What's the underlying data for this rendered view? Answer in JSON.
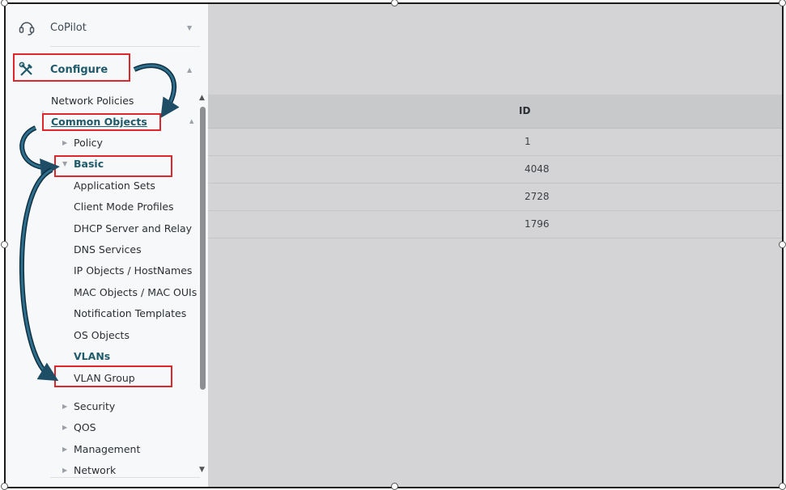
{
  "sidebar": {
    "copilot": {
      "label": "CoPilot",
      "icon": "headset-icon"
    },
    "configure": {
      "label": "Configure",
      "icon": "tools-icon"
    },
    "items": {
      "network_policies": "Network Policies",
      "common_objects": "Common Objects",
      "policy": "Policy",
      "basic": "Basic",
      "application_sets": "Application Sets",
      "client_mode_profiles": "Client Mode Profiles",
      "dhcp": "DHCP Server and Relay",
      "dns": "DNS Services",
      "ip_objects": "IP Objects / HostNames",
      "mac_objects": "MAC Objects / MAC OUIs",
      "notification_templates": "Notification Templates",
      "os_objects": "OS Objects",
      "vlans": "VLANs",
      "vlan_group": "VLAN Group",
      "security": "Security",
      "qos": "QOS",
      "management": "Management",
      "network": "Network"
    }
  },
  "table": {
    "header": "ID",
    "rows": [
      "1",
      "4048",
      "2728",
      "1796"
    ]
  },
  "colors": {
    "accent": "#1f5a6b",
    "highlight": "#e0262b",
    "arrow": "#1e4e66",
    "overlay": "#d4d4d6"
  }
}
